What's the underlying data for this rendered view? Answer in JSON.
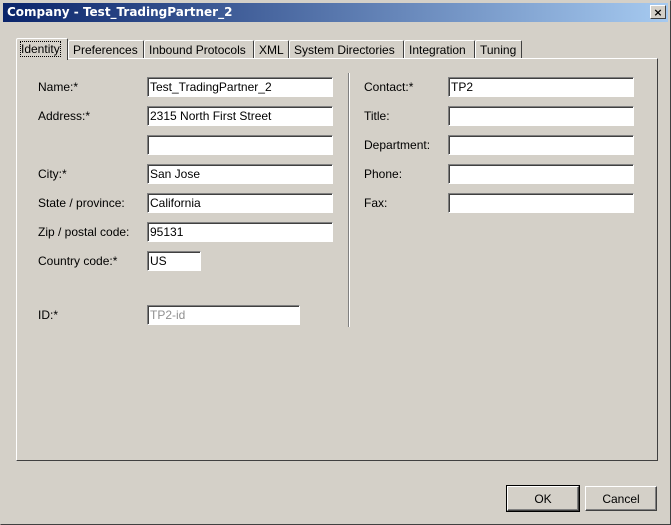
{
  "window": {
    "title": "Company - Test_TradingPartner_2",
    "close_glyph": "×"
  },
  "tabs": [
    {
      "label": "Identity",
      "active": true
    },
    {
      "label": "Preferences",
      "active": false
    },
    {
      "label": "Inbound Protocols",
      "active": false
    },
    {
      "label": "XML",
      "active": false
    },
    {
      "label": "System Directories",
      "active": false
    },
    {
      "label": "Integration",
      "active": false
    },
    {
      "label": "Tuning",
      "active": false
    }
  ],
  "left": {
    "name": {
      "label": "Name:*",
      "value": "Test_TradingPartner_2"
    },
    "address": {
      "label": "Address:*",
      "value": "2315 North First Street"
    },
    "address2": {
      "value": ""
    },
    "city": {
      "label": "City:*",
      "value": "San Jose"
    },
    "state": {
      "label": "State / province:",
      "value": "California"
    },
    "zip": {
      "label": "Zip / postal code:",
      "value": "95131"
    },
    "country": {
      "label": "Country code:*",
      "value": "US"
    },
    "id": {
      "label": "ID:*",
      "value": "TP2-id"
    }
  },
  "right": {
    "contact": {
      "label": "Contact:*",
      "value": "TP2"
    },
    "title": {
      "label": "Title:",
      "value": ""
    },
    "department": {
      "label": "Department:",
      "value": ""
    },
    "phone": {
      "label": "Phone:",
      "value": ""
    },
    "fax": {
      "label": "Fax:",
      "value": ""
    }
  },
  "buttons": {
    "ok": "OK",
    "cancel": "Cancel"
  }
}
